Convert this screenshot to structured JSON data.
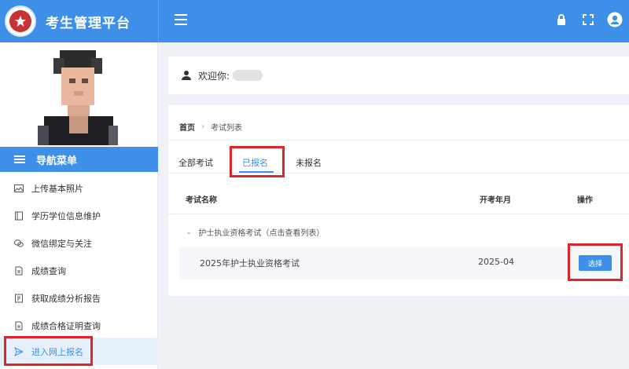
{
  "header": {
    "app_title": "考生管理平台",
    "logo_icon": "school-seal-logo",
    "icons": [
      "menu-icon",
      "lock-icon",
      "fullscreen-icon",
      "user-icon"
    ]
  },
  "sidebar": {
    "nav_title": "导航菜单",
    "items": [
      {
        "label": "上传基本照片",
        "icon": "image-icon"
      },
      {
        "label": "学历学位信息维护",
        "icon": "book-icon"
      },
      {
        "label": "微信绑定与关注",
        "icon": "wechat-icon"
      },
      {
        "label": "成绩查询",
        "icon": "document-icon"
      },
      {
        "label": "获取成绩分析报告",
        "icon": "report-icon"
      },
      {
        "label": "成绩合格证明查询",
        "icon": "document-icon"
      },
      {
        "label": "进入网上报名",
        "icon": "send-icon",
        "active": true
      }
    ]
  },
  "welcome": {
    "text": "欢迎你:"
  },
  "breadcrumb": {
    "home": "首页",
    "current": "考试列表"
  },
  "tabs": [
    {
      "label": "全部考试"
    },
    {
      "label": "已报名",
      "active": true
    },
    {
      "label": "未报名"
    }
  ],
  "table": {
    "columns": [
      "考试名称",
      "开考年月",
      "操作"
    ],
    "group_label": "护士执业资格考试（点击查看列表）",
    "rows": [
      {
        "name": "2025年护士执业资格考试",
        "date": "2025-04",
        "action": "选择"
      }
    ]
  },
  "colors": {
    "accent": "#3d8fe8",
    "highlight_box": "#e0252a"
  }
}
